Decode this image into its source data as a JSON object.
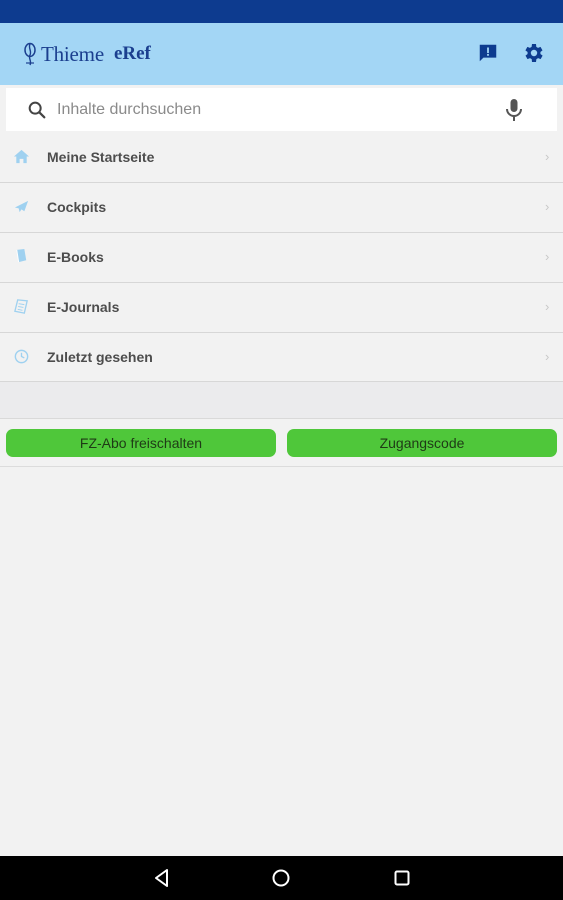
{
  "app_bar": {
    "brand": "Thieme",
    "product": "eRef",
    "icons": [
      "feedback-icon",
      "settings-icon"
    ]
  },
  "search": {
    "placeholder": "Inhalte durchsuchen",
    "value": ""
  },
  "menu": {
    "items": [
      {
        "label": "Meine Startseite",
        "icon": "home-icon"
      },
      {
        "label": "Cockpits",
        "icon": "airplane-icon"
      },
      {
        "label": "E-Books",
        "icon": "book-icon"
      },
      {
        "label": "E-Journals",
        "icon": "journal-icon"
      },
      {
        "label": "Zuletzt gesehen",
        "icon": "clock-icon"
      }
    ],
    "chevron": "›"
  },
  "actions": {
    "unlock_label": "FZ-Abo freischalten",
    "access_code_label": "Zugangscode"
  },
  "colors": {
    "status_bar": "#0d3b8f",
    "app_bar": "#a3d6f5",
    "brand": "#1b3f8f",
    "accent_green": "#4fc73a",
    "menu_icon": "#9fd1f0"
  }
}
